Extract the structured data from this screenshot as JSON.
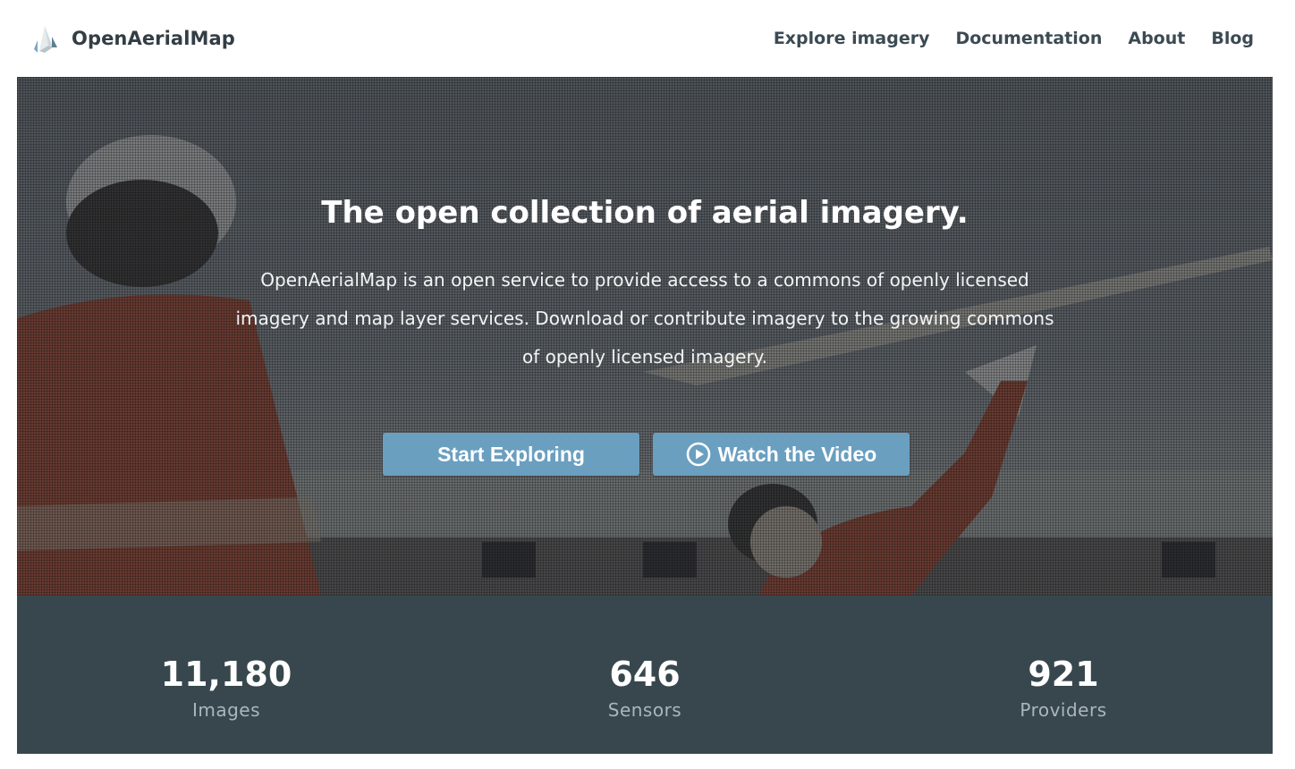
{
  "brand": {
    "name": "OpenAerialMap",
    "logo_icon": "logo-mark-icon"
  },
  "nav": {
    "items": [
      {
        "label": "Explore imagery"
      },
      {
        "label": "Documentation"
      },
      {
        "label": "About"
      },
      {
        "label": "Blog"
      }
    ]
  },
  "hero": {
    "title": "The open collection of aerial imagery.",
    "description": "OpenAerialMap is an open service to provide access to a commons of openly licensed imagery and map layer services. Download or contribute imagery to the growing commons of openly licensed imagery.",
    "primary_button": "Start Exploring",
    "video_button": "Watch the Video",
    "video_icon": "play-circle-icon"
  },
  "stats": [
    {
      "value": "11,180",
      "label": "Images"
    },
    {
      "value": "646",
      "label": "Sensors"
    },
    {
      "value": "921",
      "label": "Providers"
    }
  ],
  "colors": {
    "button": "#6a9fc0",
    "stats_band": "#37474d",
    "text_dark": "#3b4a53"
  }
}
